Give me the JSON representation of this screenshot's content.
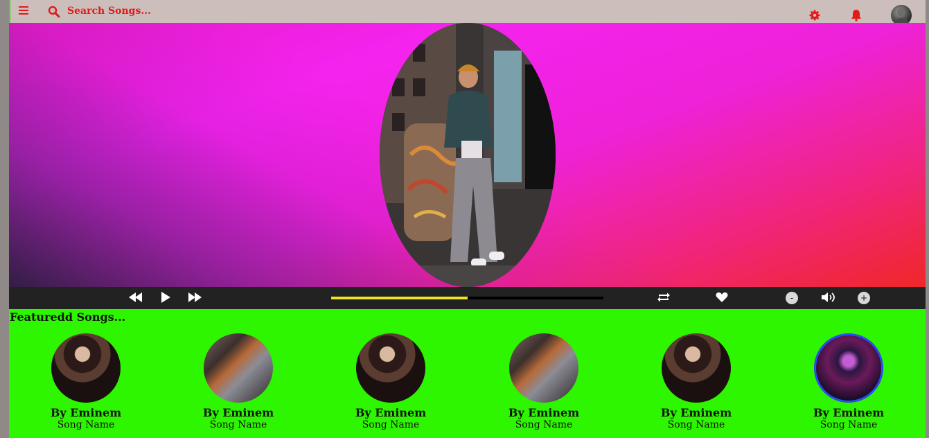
{
  "header": {
    "search_placeholder": "Search Songs...",
    "icons": [
      "menu-icon",
      "search-icon",
      "gear-icon",
      "bell-icon",
      "avatar"
    ],
    "accent_color": "#e21a1a"
  },
  "hero": {
    "gradient_colors": [
      "#f523ef",
      "#f02728",
      "#2c223a"
    ]
  },
  "player": {
    "progress": 0.5,
    "progress_color": "#f0e51c",
    "volume_decrease": "-",
    "volume_increase": "+"
  },
  "featured": {
    "title": "Featuredd Songs...",
    "background": "#2ef500",
    "songs": [
      {
        "artist": "By Eminem",
        "name": "Song Name"
      },
      {
        "artist": "By Eminem",
        "name": "Song Name"
      },
      {
        "artist": "By Eminem",
        "name": "Song Name"
      },
      {
        "artist": "By Eminem",
        "name": "Song Name"
      },
      {
        "artist": "By Eminem",
        "name": "Song Name"
      },
      {
        "artist": "By Eminem",
        "name": "Song Name"
      }
    ]
  }
}
